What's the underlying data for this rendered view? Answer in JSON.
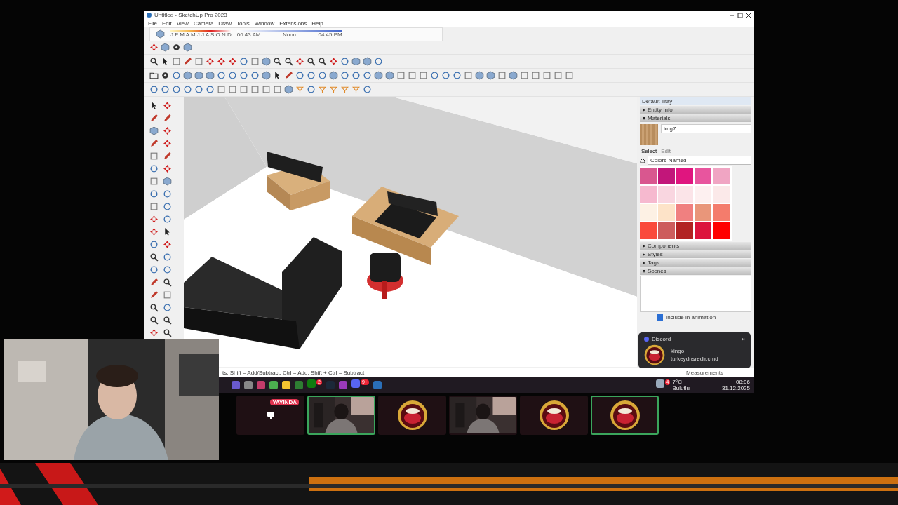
{
  "window": {
    "title": "Untitled - SketchUp Pro 2023"
  },
  "menu": [
    "File",
    "Edit",
    "View",
    "Camera",
    "Draw",
    "Tools",
    "Window",
    "Extensions",
    "Help"
  ],
  "shadows": {
    "months": "J F M A M J J A S O N D",
    "times": [
      "06:43 AM",
      "Noon",
      "04:45 PM"
    ]
  },
  "tray": {
    "title": "Default Tray",
    "panels": [
      {
        "label": "Entity Info",
        "expanded": false
      },
      {
        "label": "Materials",
        "expanded": true
      }
    ],
    "material": {
      "name": "img7",
      "tabs": [
        {
          "label": "Select",
          "selected": true
        },
        {
          "label": "Edit",
          "selected": false
        }
      ],
      "library": "Colors-Named",
      "swatches": [
        {
          "color": "#d9578f"
        },
        {
          "color": "#c2167a"
        },
        {
          "color": "#e0157f"
        },
        {
          "color": "#e8559e"
        },
        {
          "color": "#f0a5c3"
        },
        {
          "color": "#f6b9cf"
        },
        {
          "color": "#f9d6e0"
        },
        {
          "color": "#fbe4e8"
        },
        {
          "color": "#fdf0f0"
        },
        {
          "color": "#fbe9e9"
        },
        {
          "color": "#fdf1e4"
        },
        {
          "color": "#fde3c8"
        },
        {
          "color": "#f08080"
        },
        {
          "color": "#e9967a"
        },
        {
          "color": "#f47c6c"
        },
        {
          "color": "#fa4a3c"
        },
        {
          "color": "#cd5c5c"
        },
        {
          "color": "#b22222"
        },
        {
          "color": "#dc143c"
        },
        {
          "color": "#ff0000"
        }
      ]
    },
    "more_panels": [
      {
        "label": "Components",
        "expanded": false
      },
      {
        "label": "Styles",
        "expanded": false
      },
      {
        "label": "Tags",
        "expanded": false
      },
      {
        "label": "Scenes",
        "expanded": true
      }
    ],
    "include_in_animation": {
      "label": "Include in animation",
      "checked": true
    }
  },
  "status_bar": {
    "text": "ts. Shift = Add/Subtract. Ctrl = Add. Shift + Ctrl = Subtract",
    "measurements": "Measurements"
  },
  "taskbar": {
    "xbox_badge": "2",
    "discord_badge": "9+",
    "weather": {
      "badge": "4",
      "temp": "7°C",
      "condition": "Bulutlu"
    },
    "time": "08:06",
    "date": "31.12.2025"
  },
  "notification": {
    "app": "Discord",
    "more": "···",
    "close": "×",
    "sender": "kingo",
    "message": "turkeydnsredir.cmd"
  },
  "call_tiles": [
    {
      "kind": "screen",
      "badge": "YAYINDA",
      "speaking": false
    },
    {
      "kind": "picture",
      "speaking": true
    },
    {
      "kind": "avatar",
      "speaking": false
    },
    {
      "kind": "picture",
      "speaking": false
    },
    {
      "kind": "avatar",
      "speaking": false
    },
    {
      "kind": "avatar",
      "speaking": true
    }
  ]
}
